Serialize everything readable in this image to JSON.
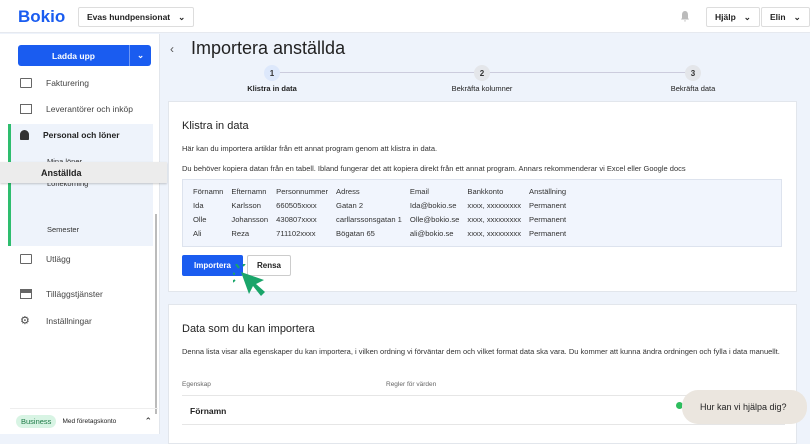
{
  "header": {
    "logo": "Bokio",
    "company": "Evas hundpensionat",
    "help": "Hjälp",
    "user": "Elin"
  },
  "sidebar": {
    "upload": "Ladda upp",
    "items": [
      {
        "label": "Fakturering"
      },
      {
        "label": "Leverantörer och inköp"
      },
      {
        "label": "Personal och löner"
      },
      {
        "label": "Utlägg"
      },
      {
        "label": "Tilläggstjänster"
      },
      {
        "label": "Inställningar"
      }
    ],
    "sub_items": [
      "Mina löner",
      "Lönekörning",
      "Anställda",
      "Semester"
    ],
    "plan_badge": "Business",
    "plan_text": "Med företagskonto"
  },
  "page": {
    "title": "Importera anställda",
    "steps": [
      {
        "num": "1",
        "label": "Klistra in data"
      },
      {
        "num": "2",
        "label": "Bekräfta kolumner"
      },
      {
        "num": "3",
        "label": "Bekräfta data"
      }
    ]
  },
  "paste": {
    "title": "Klistra in data",
    "p1": "Här kan du importera artiklar från ett annat program genom att klistra in data.",
    "p2": "Du behöver kopiera datan från en tabell. Ibland fungerar det att kopiera direkt från ett annat program. Annars rekommenderar vi Excel eller Google docs",
    "headers": [
      "Förnamn",
      "Efternamn",
      "Personnummer",
      "Adress",
      "Email",
      "Bankkonto",
      "Anställning"
    ],
    "rows": [
      [
        "Ida",
        "Karlsson",
        "660505xxxx",
        "Gatan 2",
        "Ida@bokio.se",
        "xxxx, xxxxxxxxx",
        "Permanent"
      ],
      [
        "Olle",
        "Johansson",
        "430807xxxx",
        "carllarssonsgatan 1",
        "Olle@bokio.se",
        "xxxx, xxxxxxxxx",
        "Permanent"
      ],
      [
        "Ali",
        "Reza",
        "711102xxxx",
        "Bögatan 65",
        "ali@bokio.se",
        "xxxx, xxxxxxxxx",
        "Permanent"
      ]
    ],
    "import": "Importera",
    "clear": "Rensa"
  },
  "info": {
    "title": "Data som du kan importera",
    "text": "Denna lista visar alla egenskaper du kan importera, i vilken ordning vi förväntar dem och vilket format data ska vara. Du kommer att kunna ändra ordningen och fylla i data manuellt.",
    "col1": "Egenskap",
    "col2": "Regler för värden",
    "row1": "Förnamn"
  },
  "chat": "Hur kan vi hjälpa dig?",
  "colors": {
    "brand": "#1a5cf0",
    "accent": "#2ebd6e"
  }
}
